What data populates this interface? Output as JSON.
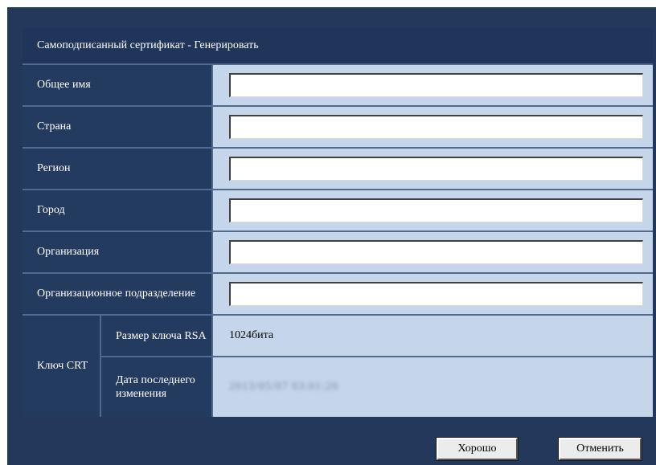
{
  "title": "Самоподписанный сертификат - Генерировать",
  "fields": [
    {
      "label": "Общее имя",
      "value": ""
    },
    {
      "label": "Страна",
      "value": ""
    },
    {
      "label": "Регион",
      "value": ""
    },
    {
      "label": "Город",
      "value": ""
    },
    {
      "label": "Организация",
      "value": ""
    },
    {
      "label": "Организационное подразделение",
      "value": ""
    }
  ],
  "crt": {
    "label": "Ключ CRT",
    "rsa_label": "Размер ключа RSA",
    "rsa_value": "1024бита",
    "date_label": "Дата последнего изменения",
    "date_value": "2013/05/07 03:01:20"
  },
  "buttons": {
    "ok": "Хорошо",
    "cancel": "Отменить"
  },
  "colors": {
    "background": "#23385a",
    "label_bg": "#243b60",
    "value_bg": "#c5d5ea",
    "divider": "#51698c"
  }
}
